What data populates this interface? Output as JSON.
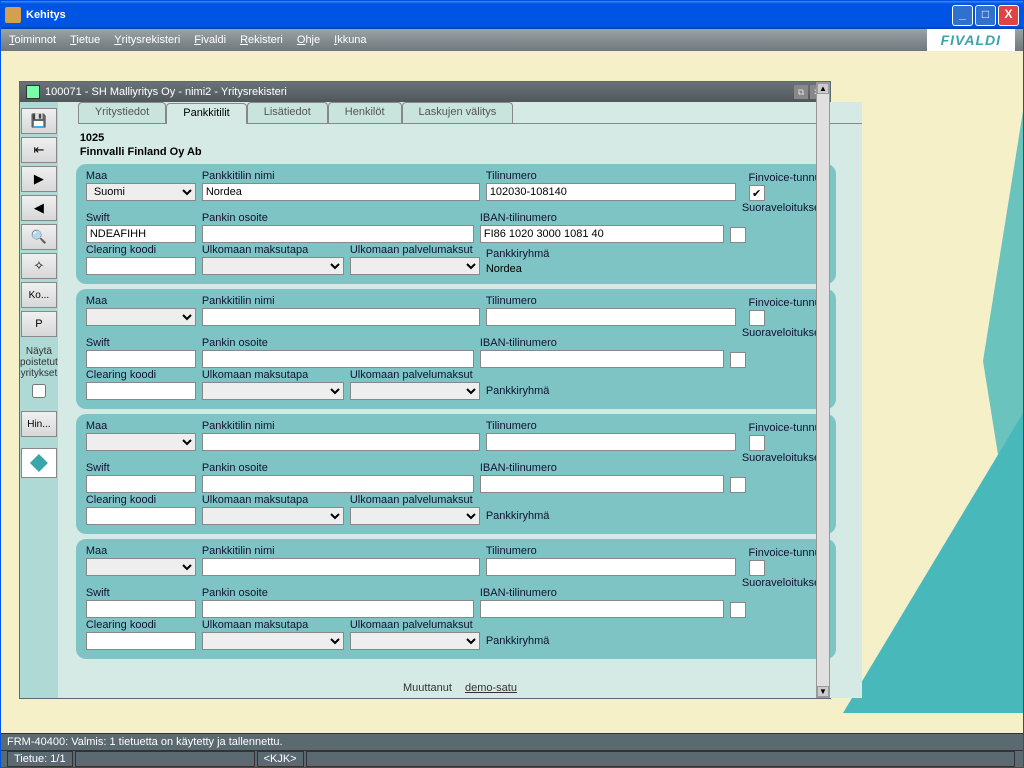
{
  "window": {
    "title": "Kehitys"
  },
  "menu": {
    "items": [
      "Toiminnot",
      "Tietue",
      "Yritysrekisteri",
      "Fivaldi",
      "Rekisteri",
      "Ohje",
      "Ikkuna"
    ],
    "brand": "FIVALDI"
  },
  "inner": {
    "title": "100071 - SH Malliyritys Oy - nimi2 - Yritysrekisteri",
    "tabs": [
      "Yritystiedot",
      "Pankkitilit",
      "Lisätiedot",
      "Henkilöt",
      "Laskujen välitys"
    ],
    "active_tab": 1,
    "header_code": "1025",
    "header_name": "Finnvalli Finland Oy Ab"
  },
  "labels": {
    "maa": "Maa",
    "pankkitilin_nimi": "Pankkitilin nimi",
    "tilinumero": "Tilinumero",
    "finvoice": "Finvoice-tunnus",
    "swift": "Swift",
    "pankin_osoite": "Pankin osoite",
    "iban": "IBAN-tilinumero",
    "suoraveloitus": "Suoraveloituksen tili",
    "clearing": "Clearing koodi",
    "ulko_maksu": "Ulkomaan maksutapa",
    "ulko_palvelu": "Ulkomaan palvelumaksut",
    "pankkiryhma": "Pankkiryhmä"
  },
  "records": [
    {
      "maa": "Suomi",
      "nimi": "Nordea",
      "tilinumero": "102030-108140",
      "finvoice": true,
      "swift": "NDEAFIHH",
      "osoite": "",
      "iban": "FI86 1020 3000 1081 40",
      "suoravel": false,
      "clearing": "",
      "ulko_maksu": "",
      "ulko_palvelu": "",
      "ryhma": "Nordea"
    },
    {
      "maa": "",
      "nimi": "",
      "tilinumero": "",
      "finvoice": false,
      "swift": "",
      "osoite": "",
      "iban": "",
      "suoravel": false,
      "clearing": "",
      "ulko_maksu": "",
      "ulko_palvelu": "",
      "ryhma": ""
    },
    {
      "maa": "",
      "nimi": "",
      "tilinumero": "",
      "finvoice": false,
      "swift": "",
      "osoite": "",
      "iban": "",
      "suoravel": false,
      "clearing": "",
      "ulko_maksu": "",
      "ulko_palvelu": "",
      "ryhma": ""
    },
    {
      "maa": "",
      "nimi": "",
      "tilinumero": "",
      "finvoice": false,
      "swift": "",
      "osoite": "",
      "iban": "",
      "suoravel": false,
      "clearing": "",
      "ulko_maksu": "",
      "ulko_palvelu": "",
      "ryhma": ""
    }
  ],
  "sidebar": {
    "nayta_label": "Näytä poistetut yritykset",
    "ko": "Ko...",
    "p": "P",
    "hin": "Hin..."
  },
  "footer": {
    "muuttanut_label": "Muuttanut",
    "muuttanut": "demo-satu"
  },
  "status": {
    "line1": "FRM-40400: Valmis: 1 tietuetta on käytetty ja tallennettu.",
    "tietue": "Tietue: 1/1",
    "kjk": "<KJK>"
  }
}
